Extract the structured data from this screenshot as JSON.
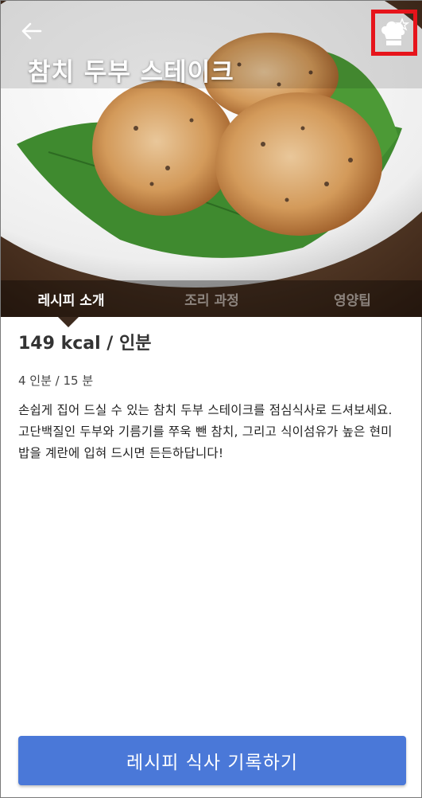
{
  "header": {
    "title": "참치 두부 스테이크"
  },
  "icons": {
    "back": "arrow-left-icon",
    "chef": "chef-hat-star-icon"
  },
  "tabs": [
    {
      "label": "레시피 소개",
      "active": true
    },
    {
      "label": "조리 과정",
      "active": false
    },
    {
      "label": "영양팁",
      "active": false
    }
  ],
  "recipe": {
    "kcal": "149 kcal / 인분",
    "servings": "4 인분 / 15 분",
    "description": "손쉽게 집어 드실 수 있는 참치 두부 스테이크를 점심식사로 드셔보세요. 고단백질인 두부와 기름기를 쭈욱 뺀 참치, 그리고 식이섬유가 높은 현미밥을 계란에 입혀 드시면 든든하답니다!"
  },
  "actions": {
    "record_label": "레시피 식사 기록하기"
  },
  "colors": {
    "accent": "#4a78d8",
    "highlight_border": "#e6141b"
  }
}
